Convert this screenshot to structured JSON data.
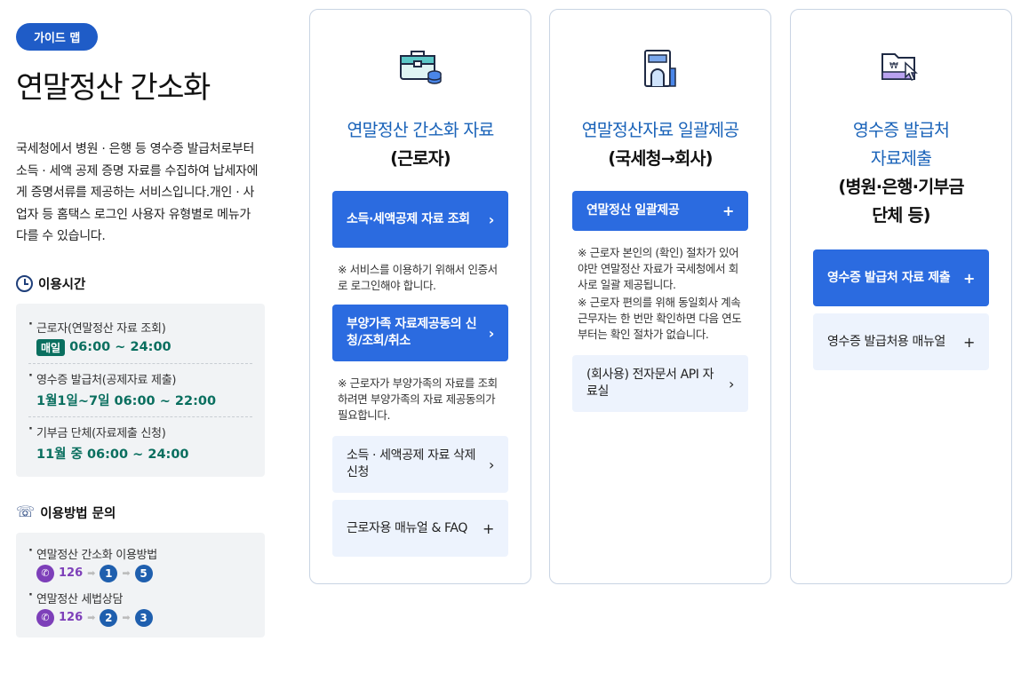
{
  "sidebar": {
    "badge": "가이드 맵",
    "title": "연말정산 간소화",
    "description": "국세청에서 병원 · 은행 등 영수증 발급처로부터 소득 · 세액 공제 증명 자료를 수집하여 납세자에게 증명서류를 제공하는 서비스입니다.개인 · 사업자 등 홈택스 로그인 사용자 유형별로 메뉴가 다를 수 있습니다.",
    "hours": {
      "heading": "이용시간",
      "items": [
        {
          "label": "근로자(연말정산 자료 조회)",
          "tag": "매일",
          "value": "06:00 ~ 24:00"
        },
        {
          "label": "영수증 발급처(공제자료 제출)",
          "value": "1월1일~7일 06:00 ~ 22:00"
        },
        {
          "label": "기부금 단체(자료제출 신청)",
          "value": "11월 중 06:00 ~ 24:00"
        }
      ]
    },
    "contact": {
      "heading": "이용방법 문의",
      "items": [
        {
          "label": "연말정산 간소화 이용방법",
          "phone": "126",
          "steps": [
            "1",
            "5"
          ]
        },
        {
          "label": "연말정산 세법상담",
          "phone": "126",
          "steps": [
            "2",
            "3"
          ]
        }
      ]
    }
  },
  "cards": [
    {
      "icon": "toolbox-icon",
      "title_line1": "연말정산 간소화 자료",
      "title_line2": "(근로자)",
      "buttons": [
        {
          "label": "소득·세액공제 자료 조회",
          "symbol": "›"
        },
        {
          "label": "부양가족 자료제공동의 신청/조회/취소",
          "symbol": "›"
        },
        {
          "label": "소득 · 세액공제 자료 삭제 신청",
          "symbol": "›"
        },
        {
          "label": "근로자용 매뉴얼 & FAQ",
          "symbol": "+"
        }
      ],
      "notes": [
        "※ 서비스를 이용하기 위해서 인증서로 로그인해야 합니다.",
        "※ 근로자가 부양가족의 자료를 조회하려면 부양가족의 자료 제공동의가 필요합니다."
      ]
    },
    {
      "icon": "building-icon",
      "title_line1": "연말정산자료 일괄제공",
      "title_line2": "(국세청→회사)",
      "buttons": [
        {
          "label": "연말정산 일괄제공",
          "symbol": "+"
        },
        {
          "label": "(회사용) 전자문서 API 자료실",
          "symbol": "›"
        }
      ],
      "notes": [
        "※ 근로자 본인의 (확인) 절차가 있어야만 연말정산 자료가 국세청에서 회사로 일괄 제공됩니다.",
        "※ 근로자 편의를 위해 동일회사 계속 근무자는 한 번만 확인하면 다음 연도부터는 확인 절차가 없습니다."
      ]
    },
    {
      "icon": "receipt-folder-icon",
      "title_line1": "영수증 발급처",
      "title_line1b": "자료제출",
      "title_line2": "(병원·은행·기부금",
      "title_line2b": "단체 등)",
      "buttons": [
        {
          "label": "영수증 발급처 자료 제출",
          "symbol": "+"
        },
        {
          "label": "영수증 발급처용 매뉴얼",
          "symbol": "+"
        }
      ]
    }
  ],
  "colors": {
    "accent": "#2b6be0",
    "title_blue": "#1a63b9",
    "time_green": "#0a6f5f",
    "phone_purple": "#7d3fb9"
  }
}
